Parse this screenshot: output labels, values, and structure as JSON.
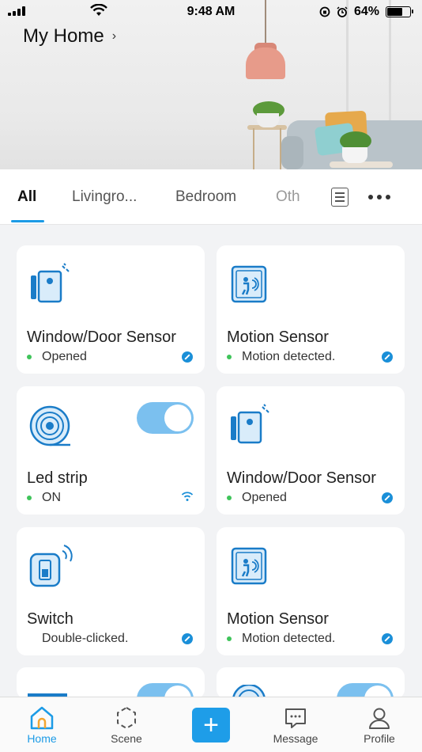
{
  "status_bar": {
    "time": "9:48 AM",
    "battery": "64%"
  },
  "header": {
    "home_name": "My Home",
    "chevron": "›"
  },
  "tabs": [
    {
      "label": "All",
      "active": true
    },
    {
      "label": "Livingro...",
      "active": false
    },
    {
      "label": "Bedroom",
      "active": false
    },
    {
      "label": "Oth",
      "active": false
    }
  ],
  "devices": [
    {
      "name": "Window/Door Sensor",
      "status": "Opened",
      "icon": "door-sensor-icon",
      "online_dot": true,
      "badge": "zigbee-icon"
    },
    {
      "name": "Motion Sensor",
      "status": "Motion detected.",
      "icon": "motion-sensor-icon",
      "online_dot": true,
      "badge": "zigbee-icon"
    },
    {
      "name": "Led strip",
      "status": "ON",
      "icon": "led-strip-icon",
      "online_dot": true,
      "badge": "wifi-icon",
      "toggle_on": true
    },
    {
      "name": "Window/Door Sensor",
      "status": "Opened",
      "icon": "door-sensor-icon",
      "online_dot": true,
      "badge": "zigbee-icon"
    },
    {
      "name": "Switch",
      "status": "Double-clicked.",
      "icon": "wireless-switch-icon",
      "online_dot": false,
      "badge": "zigbee-icon"
    },
    {
      "name": "Motion Sensor",
      "status": "Motion detected.",
      "icon": "motion-sensor-icon",
      "online_dot": true,
      "badge": "zigbee-icon"
    }
  ],
  "bottom_nav": [
    {
      "label": "Home",
      "icon": "home-icon",
      "active": true
    },
    {
      "label": "Scene",
      "icon": "scene-icon",
      "active": false
    },
    {
      "label": "+",
      "icon": "add-icon",
      "active": false
    },
    {
      "label": "Message",
      "icon": "message-icon",
      "active": false
    },
    {
      "label": "Profile",
      "icon": "profile-icon",
      "active": false
    }
  ],
  "colors": {
    "accent": "#1c9be6",
    "online": "#3fc45a",
    "toggle": "#7bc0ef",
    "lamp": "#e79b8a"
  }
}
